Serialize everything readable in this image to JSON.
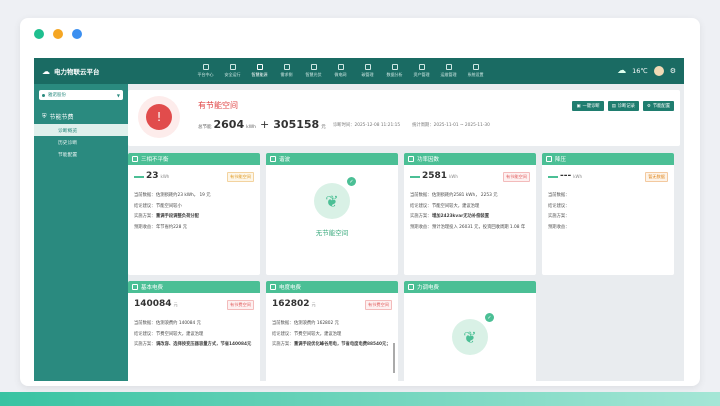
{
  "app": {
    "title": "电力物联云平台"
  },
  "nav": [
    {
      "label": "平台中心"
    },
    {
      "label": "安全运行"
    },
    {
      "label": "智慧能源"
    },
    {
      "label": "需求侧"
    },
    {
      "label": "智慧光伏"
    },
    {
      "label": "微电网"
    },
    {
      "label": "碳管理"
    },
    {
      "label": "数据分析"
    },
    {
      "label": "资产管理"
    },
    {
      "label": "运维管理"
    },
    {
      "label": "系统设置"
    }
  ],
  "weather": {
    "temp": "16℃"
  },
  "sidebar": {
    "org": "雅诺股份",
    "menu_title": "节能节费",
    "items": [
      {
        "label": "诊断概览"
      },
      {
        "label": "历史诊断"
      },
      {
        "label": "节能配置"
      }
    ]
  },
  "summary": {
    "title": "有节能空间",
    "energy_label": "总节能",
    "energy_value": "2604",
    "energy_unit": "kWh",
    "plus": "+",
    "money_value": "305158",
    "money_unit": "元",
    "diag_time": "诊断时间：2025-12-08 11:21:15",
    "period": "统计周期：2025-11-01 ~ 2025-11-30",
    "buttons": [
      {
        "label": "一键诊断"
      },
      {
        "label": "诊断记录"
      },
      {
        "label": "节能配置"
      }
    ]
  },
  "cards": {
    "c1": {
      "title": "三相不平衡",
      "value": "23",
      "unit": "kWh",
      "tag": "有节能空间",
      "rows": [
        {
          "label": "当前数据：",
          "value": "估测损耗约23 kWh，  19 元"
        },
        {
          "label": "结论建议：",
          "value": "节能空间较小"
        },
        {
          "label": "实施方案：",
          "value": "重调手段调整负荷分配"
        },
        {
          "label": "预期收益：",
          "value": "年节省约228 元"
        }
      ]
    },
    "c2": {
      "title": "谐波",
      "leaf_text": "无节能空间"
    },
    "c3": {
      "title": "功率因数",
      "value": "2581",
      "unit": "kWh",
      "tag": "有节能空间",
      "rows": [
        {
          "label": "当前数据：",
          "value": "估测损耗约2581 kWh，  2253 元"
        },
        {
          "label": "结论建议：",
          "value": "节能空间较大，建议治理"
        },
        {
          "label": "实施方案：",
          "value": "增加2423kvar无功补偿装置"
        },
        {
          "label": "预期收益：",
          "value": "预计治理投入 26031 元，投资回收周期 1.08 年"
        }
      ]
    },
    "c4": {
      "title": "降压",
      "value": "---",
      "unit": "kWh",
      "tag": "暂无数据",
      "rows": [
        {
          "label": "当前数据：",
          "value": ""
        },
        {
          "label": "结论建议：",
          "value": ""
        },
        {
          "label": "实施方案：",
          "value": ""
        },
        {
          "label": "预期收益：",
          "value": ""
        }
      ]
    },
    "c5": {
      "title": "基本电费",
      "value": "140084",
      "unit": "元",
      "tag": "有节费空间",
      "rows": [
        {
          "label": "当前数据：",
          "value": "估测浪费约 140084 元"
        },
        {
          "label": "结论建议：",
          "value": "节费空间较大，建议治理"
        },
        {
          "label": "实施方案：",
          "value": "调改容、选择按变压器容量方式，节省140084元"
        }
      ]
    },
    "c6": {
      "title": "电度电费",
      "value": "162802",
      "unit": "元",
      "tag": "有节费空间",
      "rows": [
        {
          "label": "当前数据：",
          "value": "估测浪费约 162802 元"
        },
        {
          "label": "结论建议：",
          "value": "节费空间较大，建议治理"
        },
        {
          "label": "实施方案：",
          "value": "重调手段优化峰谷用电，节省电度电费88540元；"
        }
      ]
    },
    "c7": {
      "title": "力调电费"
    }
  }
}
